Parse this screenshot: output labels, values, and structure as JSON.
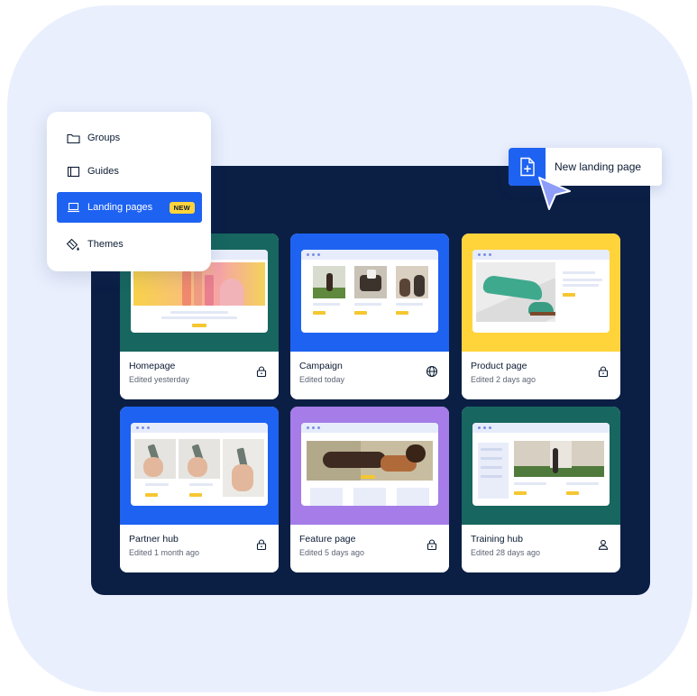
{
  "menu": {
    "items": [
      {
        "label": "Groups",
        "icon": "folder-icon"
      },
      {
        "label": "Guides",
        "icon": "book-icon"
      },
      {
        "label": "Landing pages",
        "icon": "laptop-icon",
        "badge": "NEW",
        "active": true
      },
      {
        "label": "Themes",
        "icon": "paint-bucket-icon"
      }
    ]
  },
  "new_button": {
    "label": "New landing page",
    "icon": "new-file-icon"
  },
  "cards": [
    {
      "title": "Homepage",
      "subtitle": "Edited yesterday",
      "status_icon": "lock-icon",
      "color": "#17665f"
    },
    {
      "title": "Campaign",
      "subtitle": "Edited today",
      "status_icon": "globe-icon",
      "color": "#1e62f2"
    },
    {
      "title": "Product page",
      "subtitle": "Edited 2 days ago",
      "status_icon": "lock-icon",
      "color": "#ffd43b"
    },
    {
      "title": "Partner hub",
      "subtitle": "Edited 1 month ago",
      "status_icon": "lock-icon",
      "color": "#1e62f2"
    },
    {
      "title": "Feature page",
      "subtitle": "Edited 5 days ago",
      "status_icon": "lock-icon",
      "color": "#a57ce8"
    },
    {
      "title": "Training hub",
      "subtitle": "Edited 28 days ago",
      "status_icon": "user-icon",
      "color": "#17665f"
    }
  ],
  "colors": {
    "accent": "#1e62f2",
    "panel": "#0b1f45",
    "background": "#e9effd",
    "badge": "#ffd43b"
  }
}
